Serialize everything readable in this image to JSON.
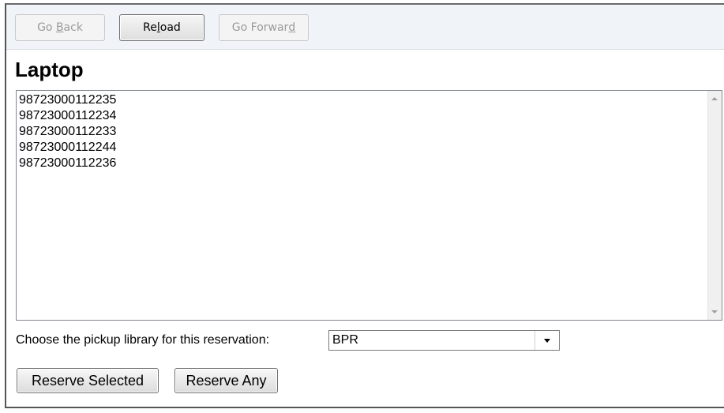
{
  "toolbar": {
    "back": {
      "pre": "Go ",
      "key": "B",
      "post": "ack"
    },
    "reload": {
      "pre": "Re",
      "key": "l",
      "post": "oad"
    },
    "forward": {
      "pre": "Go Forwar",
      "key": "d",
      "post": ""
    }
  },
  "page": {
    "title": "Laptop"
  },
  "items": [
    "98723000112235",
    "98723000112234",
    "98723000112233",
    "98723000112244",
    "98723000112236"
  ],
  "pickup": {
    "label": "Choose the pickup library for this reservation:",
    "selected": "BPR"
  },
  "actions": {
    "reserve_selected": "Reserve Selected",
    "reserve_any": "Reserve Any"
  },
  "icons": {
    "scroll_up": "scroll-up-arrow-icon",
    "scroll_down": "scroll-down-arrow-icon",
    "dropdown": "chevron-down-icon"
  }
}
